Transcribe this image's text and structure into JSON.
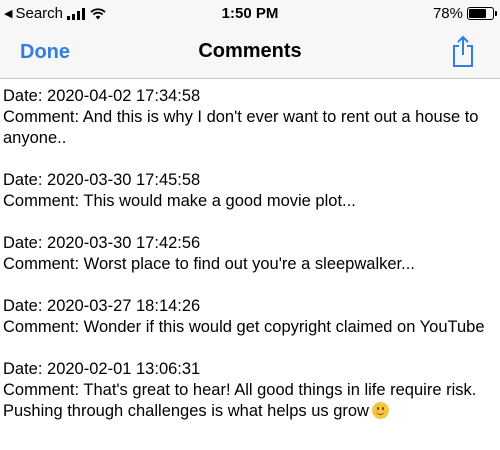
{
  "status_bar": {
    "back_label": "Search",
    "time": "1:50 PM",
    "battery": "78%",
    "battery_level": 0.78
  },
  "nav": {
    "done_label": "Done",
    "title": "Comments",
    "share_icon": "share-icon",
    "accent_color": "#2f7fe0"
  },
  "comments": [
    {
      "date": "Date: 2020-04-02 17:34:58",
      "comment": "Comment: And this is why I don't ever want to rent out a house to anyone.."
    },
    {
      "date": "Date: 2020-03-30 17:45:58",
      "comment": "Comment: This would make a good movie plot..."
    },
    {
      "date": "Date: 2020-03-30 17:42:56",
      "comment": "Comment: Worst place to find out you're a sleepwalker..."
    },
    {
      "date": "Date: 2020-03-27 18:14:26",
      "comment": "Comment: Wonder if this would get copyright claimed on YouTube"
    },
    {
      "date": "Date: 2020-02-01 13:06:31",
      "comment": "Comment: That's great to hear! All good things in life require risk. Pushing through challenges is what helps us grow",
      "emoji": "smiling-face-icon"
    }
  ]
}
